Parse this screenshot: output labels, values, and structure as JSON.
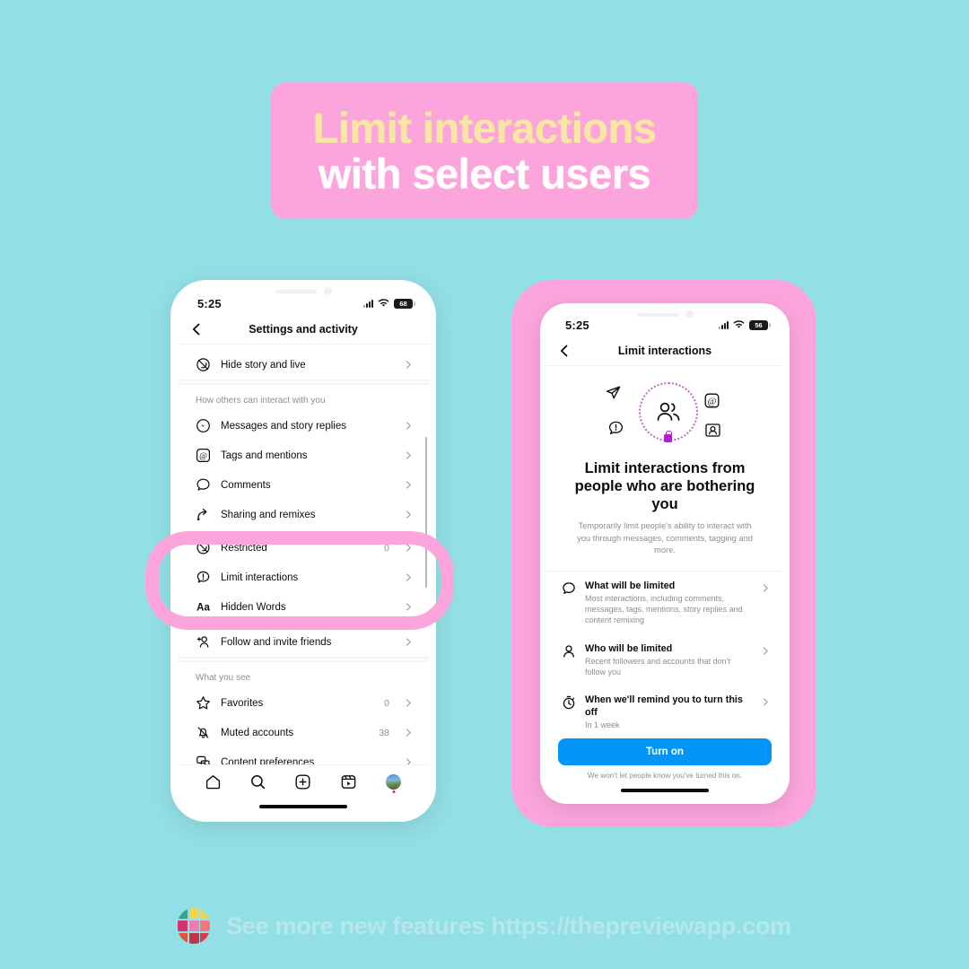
{
  "background_color": "#92dfe5",
  "banner": {
    "bg_color": "#fba5dc",
    "line1": "Limit interactions",
    "line1_color": "#f8e6a4",
    "line2": "with select users",
    "line2_color": "#ffffff"
  },
  "phone_left": {
    "status": {
      "time": "5:25",
      "battery": "68",
      "wifi_icon": "wifi-icon",
      "signal_icon": "signal-bars-icon"
    },
    "header": {
      "title": "Settings and activity",
      "back_icon": "back-chevron-icon"
    },
    "rows_top": [
      {
        "icon": "hide-story-icon",
        "label": "Hide story and live",
        "count": ""
      }
    ],
    "section_1_header": "How others can interact with you",
    "rows_section_1": [
      {
        "icon": "messenger-icon",
        "label": "Messages and story replies",
        "count": ""
      },
      {
        "icon": "at-mention-icon",
        "label": "Tags and mentions",
        "count": ""
      },
      {
        "icon": "comment-bubble-icon",
        "label": "Comments",
        "count": ""
      },
      {
        "icon": "share-remix-icon",
        "label": "Sharing and remixes",
        "count": ""
      },
      {
        "icon": "restricted-icon",
        "label": "Restricted",
        "count": "0"
      },
      {
        "icon": "limit-interactions-icon",
        "label": "Limit interactions",
        "count": ""
      },
      {
        "icon": "hidden-words-icon",
        "label": "Hidden Words",
        "count": ""
      },
      {
        "icon": "follow-invite-icon",
        "label": "Follow and invite friends",
        "count": ""
      }
    ],
    "section_2_header": "What you see",
    "rows_section_2": [
      {
        "icon": "star-icon",
        "label": "Favorites",
        "count": "0"
      },
      {
        "icon": "muted-bell-icon",
        "label": "Muted accounts",
        "count": "38"
      },
      {
        "icon": "content-preferences-icon",
        "label": "Content preferences",
        "count": ""
      }
    ],
    "tabbar": [
      {
        "icon": "home-icon"
      },
      {
        "icon": "search-icon"
      },
      {
        "icon": "create-plus-icon"
      },
      {
        "icon": "reels-icon"
      },
      {
        "icon": "profile-avatar"
      }
    ]
  },
  "phone_right": {
    "frame_color": "#fba5dc",
    "status": {
      "time": "5:25",
      "battery": "56",
      "wifi_icon": "wifi-icon",
      "signal_icon": "signal-bars-icon"
    },
    "header": {
      "title": "Limit interactions",
      "back_icon": "back-chevron-icon"
    },
    "hero": {
      "center_icon": "people-group-icon",
      "surrounding_icons": [
        "direct-message-icon",
        "at-mention-icon",
        "alert-bubble-icon",
        "contact-card-icon"
      ],
      "lock_icon": "lock-icon",
      "lock_color": "#a726c9"
    },
    "title": "Limit interactions from people who are bothering you",
    "subtitle": "Temporarily limit people's ability to interact with you through messages, comments, tagging and more.",
    "options": [
      {
        "icon": "comment-bubble-icon",
        "title": "What will be limited",
        "description": "Most interactions, including comments, messages, tags, mentions, story replies and content remixing"
      },
      {
        "icon": "person-icon",
        "title": "Who will be limited",
        "description": "Recent followers and accounts that don't follow you"
      },
      {
        "icon": "stopwatch-icon",
        "title": "When we'll remind you to turn this off",
        "description": "In 1 week"
      }
    ],
    "cta": {
      "label": "Turn on",
      "color": "#0095f6"
    },
    "disclaimer": "We won't let people know you've turned this on."
  },
  "highlight": {
    "color": "#fba5dc",
    "targets": [
      "Restricted",
      "Limit interactions",
      "Hidden Words"
    ]
  },
  "footer": {
    "logo_icon": "preview-app-logo",
    "logo_colors": [
      "#3aa38f",
      "#f2d54e",
      "#f2d54e",
      "#d6316f",
      "#f27bb0",
      "#f07a7a",
      "#e0533c",
      "#c0334a",
      "#d93b4a"
    ],
    "text": "See more new features https://thepreviewapp.com",
    "text_color": "#b6e7ec"
  }
}
